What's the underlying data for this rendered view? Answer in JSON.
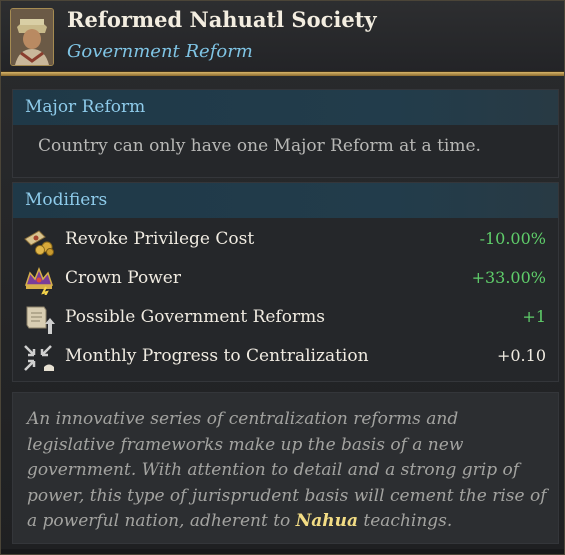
{
  "header": {
    "title": "Reformed Nahuatl Society",
    "subtitle": "Government Reform",
    "portrait_icon": "noble-portrait-icon"
  },
  "major_reform": {
    "title": "Major Reform",
    "text": "Country can only have one Major Reform at a time."
  },
  "modifiers": {
    "title": "Modifiers",
    "items": [
      {
        "icon": "privilege-icon",
        "label": "Revoke Privilege Cost",
        "value": "-10.00%",
        "color": "#5fcd6a"
      },
      {
        "icon": "crown-power-icon",
        "label": "Crown Power",
        "value": "+33.00%",
        "color": "#5fcd6a"
      },
      {
        "icon": "government-reform-icon",
        "label": "Possible Government Reforms",
        "value": "+1",
        "color": "#5fcd6a"
      },
      {
        "icon": "centralization-icon",
        "label": "Monthly Progress to Centralization",
        "value": "+0.10",
        "color": "#f0ebe1"
      }
    ]
  },
  "flavor": {
    "text_before": "An innovative series of centralization reforms and legislative frameworks make up the basis of a new government. With attention to detail and a strong grip of power, this type of jurisprudent basis will cement the rise of a powerful nation, adherent to ",
    "highlight": "Nahua",
    "text_after": " teachings."
  },
  "colors": {
    "accent_gold": "#d7b56a",
    "section_title": "#8ecbea",
    "subtitle": "#7fc4e4",
    "positive": "#5fcd6a",
    "highlight": "#f2dc84"
  }
}
